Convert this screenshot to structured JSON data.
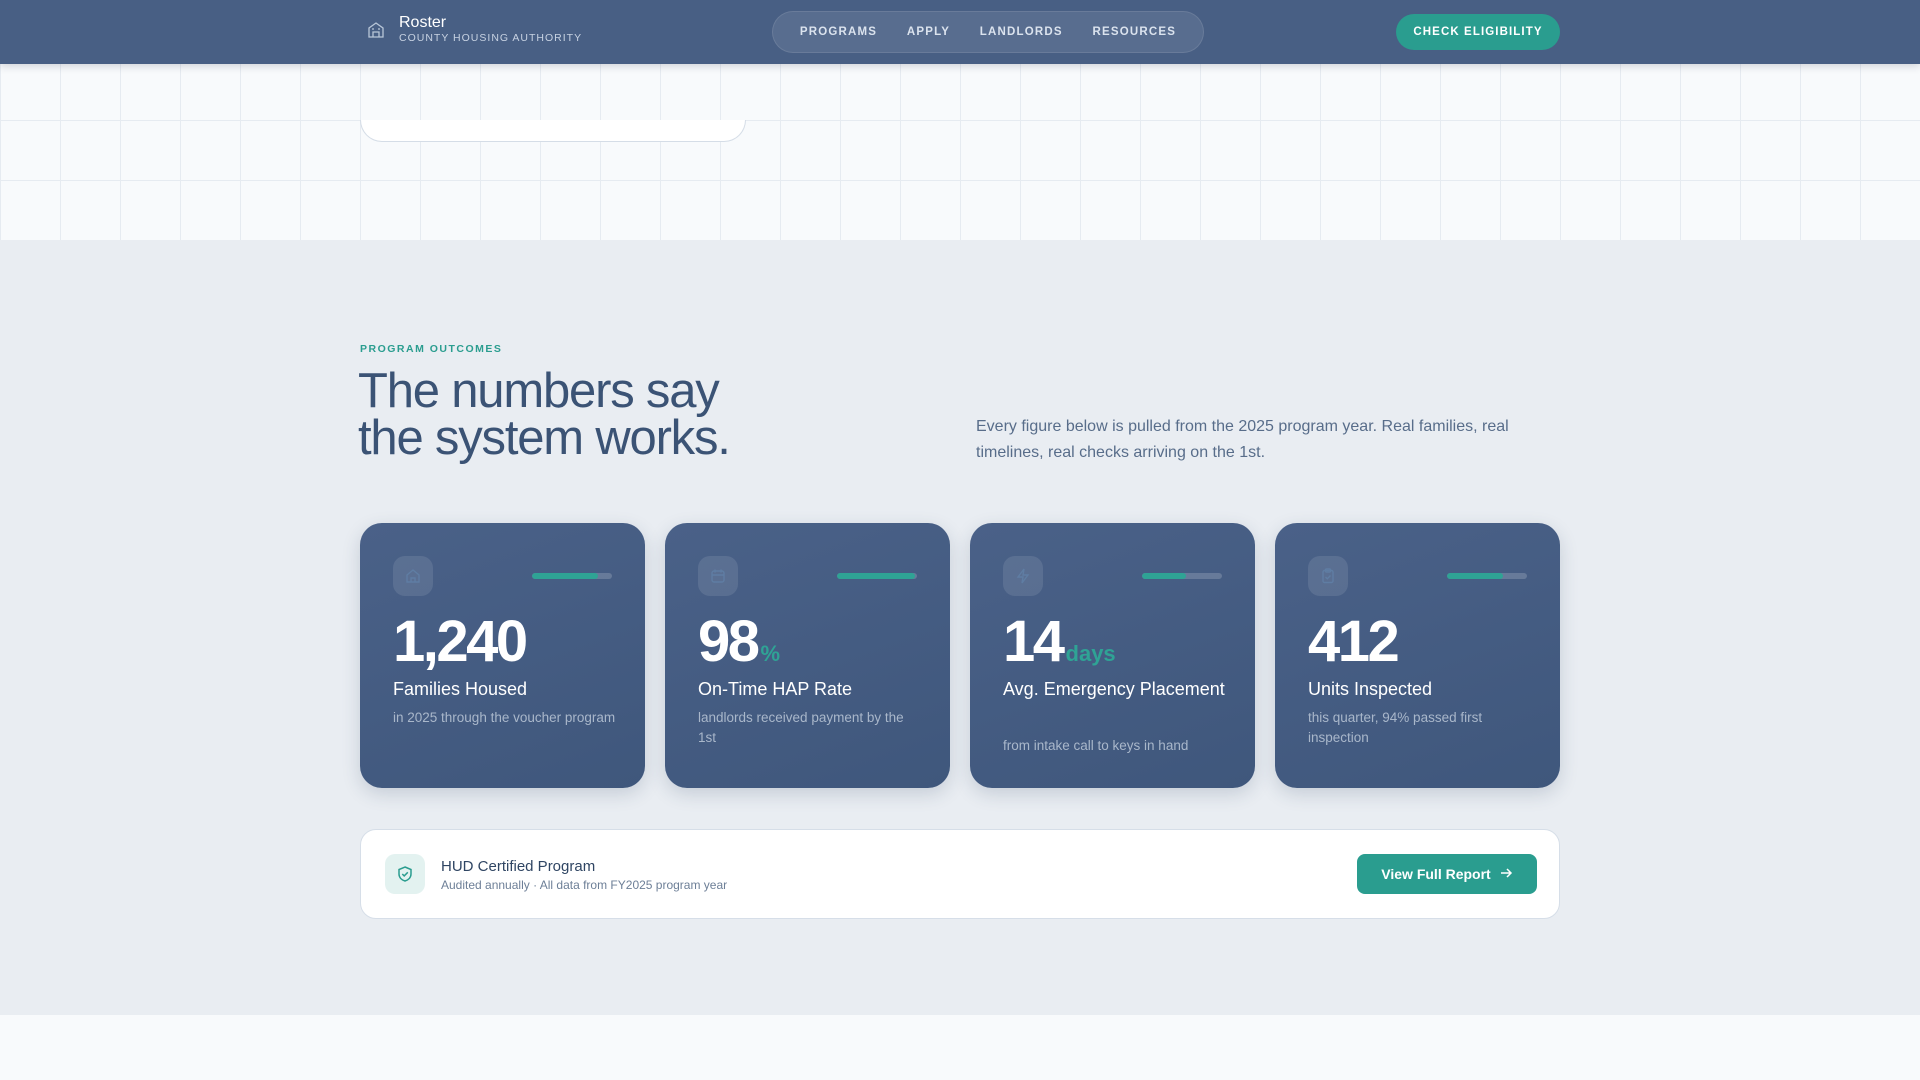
{
  "header": {
    "brand_name": "Roster",
    "brand_subtitle": "COUNTY HOUSING AUTHORITY",
    "brand_icon": "building-icon",
    "nav": [
      "PROGRAMS",
      "APPLY",
      "LANDLORDS",
      "RESOURCES"
    ],
    "cta_label": "CHECK ELIGIBILITY"
  },
  "outcomes": {
    "eyebrow": "PROGRAM OUTCOMES",
    "headline_line1": "The numbers say",
    "headline_line2": "the system works.",
    "lede": "Every figure below is pulled from the 2025 program year. Real families, real timelines, real checks arriving on the 1st.",
    "cards": [
      {
        "icon": "home-icon",
        "progress": 0.82,
        "value": "1,240",
        "unit": "",
        "title": "Families Housed",
        "desc": "in 2025 through the voucher program"
      },
      {
        "icon": "calendar-icon",
        "progress": 0.98,
        "value": "98",
        "unit": "%",
        "title": "On-Time HAP Rate",
        "desc": "landlords received payment by the 1st"
      },
      {
        "icon": "lightning-icon",
        "progress": 0.55,
        "value": "14",
        "unit": "days",
        "title": "Avg. Emergency Placement",
        "desc": "from intake call to keys in hand"
      },
      {
        "icon": "clipboard-icon",
        "progress": 0.7,
        "value": "412",
        "unit": "",
        "title": "Units Inspected",
        "desc": "this quarter, 94% passed first inspection"
      }
    ]
  },
  "certification": {
    "icon": "shield-check-icon",
    "title": "HUD Certified Program",
    "subtitle": "Audited annually · All data from FY2025 program year",
    "button_label": "View Full Report"
  },
  "colors": {
    "header_bg": "#485f84",
    "accent": "#2a9d8f",
    "card_bg": "#465d84",
    "section_bg": "#e9edf2"
  }
}
